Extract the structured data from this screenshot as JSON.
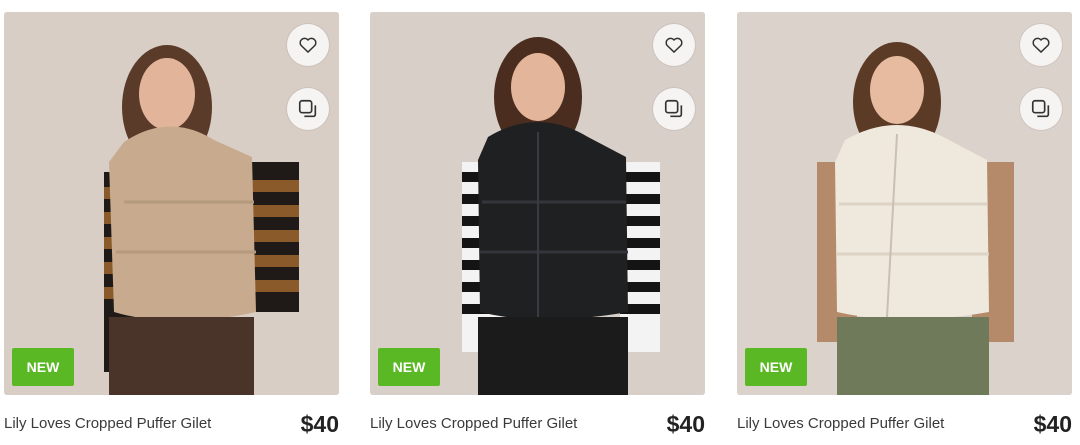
{
  "products": [
    {
      "name": "Lily Loves Cropped Puffer Gilet",
      "price": "$40",
      "badge": "NEW",
      "colors": {
        "bg": "#d9cec6",
        "vest": "#c8ab8f",
        "stripe1": "#1f1a17",
        "stripe2": "#8a5a2b",
        "pants": "#4a3328",
        "hair": "#5a3a28"
      }
    },
    {
      "name": "Lily Loves Cropped Puffer Gilet",
      "price": "$40",
      "badge": "NEW",
      "colors": {
        "bg": "#d8cfc9",
        "vest": "#1f2022",
        "stripe1": "#141414",
        "stripe2": "#f3f3f3",
        "pants": "#1b1b1b",
        "hair": "#4a2d1f"
      }
    },
    {
      "name": "Lily Loves Cropped Puffer Gilet",
      "price": "$40",
      "badge": "NEW",
      "colors": {
        "bg": "#dcd2cc",
        "vest": "#efe8dc",
        "stripe1": "#b58a6a",
        "stripe2": "#b58a6a",
        "pants": "#6e7a5a",
        "hair": "#5b3a26"
      }
    }
  ]
}
